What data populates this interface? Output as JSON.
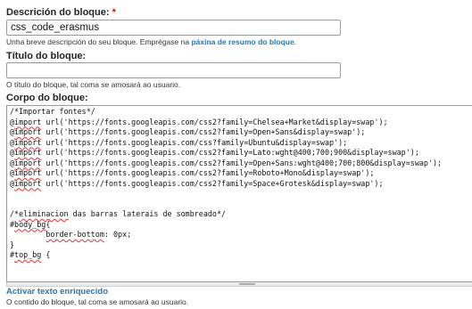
{
  "description_field": {
    "label": "Descrición do bloque:",
    "required_mark": "*",
    "value": "css_code_erasmus",
    "help_prefix": "Unha breve descripción do seu bloque. Emprégase na ",
    "help_link": "páxina de resumo do bloque",
    "help_suffix": "."
  },
  "title_field": {
    "label": "Título do bloque:",
    "value": "",
    "help": "O título do bloque, tal coma se amosará ao usuario."
  },
  "body_field": {
    "label": "Corpo do bloque:",
    "code_lines": [
      "/*Importar fontes*/",
      "@import url('https://fonts.googleapis.com/css2?family=Chelsea+Market&display=swap');",
      "@import url('https://fonts.googleapis.com/css2?family=Open+Sans&display=swap');",
      "@import url('https://fonts.googleapis.com/css?family=Ubuntu&display=swap');",
      "@import url('https://fonts.googleapis.com/css2?family=Lato:wght@400;700;900&display=swap');",
      "@import url('https://fonts.googleapis.com/css2?family=Open+Sans:wght@400;700;800&display=swap');",
      "@import url('https://fonts.googleapis.com/css2?family=Roboto+Mono&display=swap');",
      "@import url('https://fonts.googleapis.com/css2?family=Space+Grotesk&display=swap');",
      "",
      "",
      "/*eliminacion das barras laterais de sombreado*/",
      "#body_bg{",
      "        border-bottom: 0px;",
      "}",
      "#top_bg {"
    ]
  },
  "rich_text_toggle": {
    "label": "Activar texto enriquecido",
    "help": "O contido do bloque, tal coma se amosará ao usuario."
  }
}
